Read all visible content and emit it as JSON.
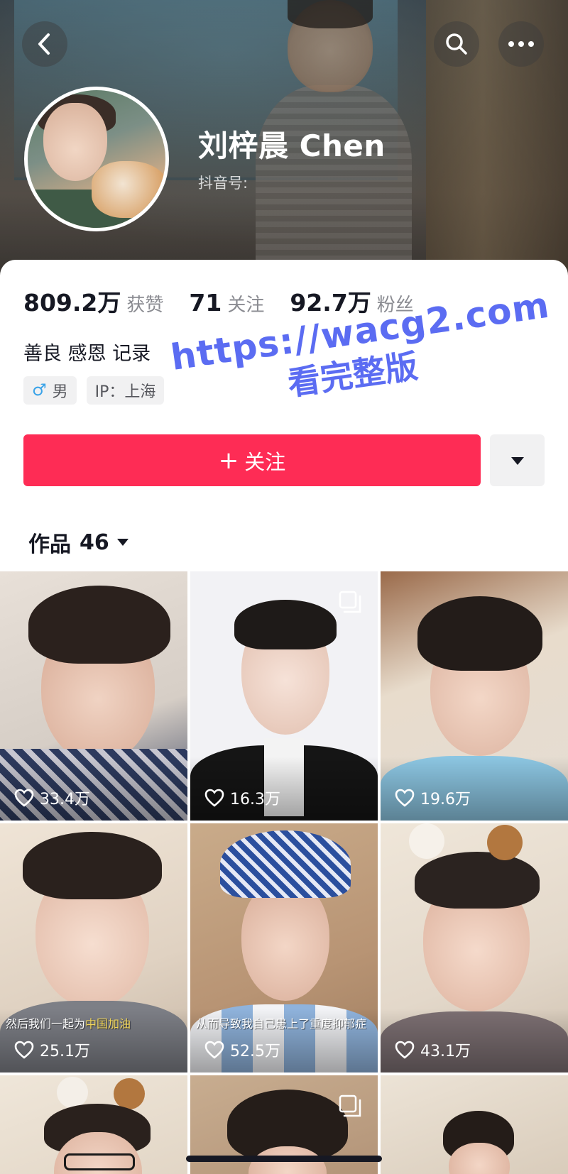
{
  "header": {
    "back_icon": "chevron-left-icon",
    "search_icon": "search-icon",
    "more_icon": "more-dots-icon"
  },
  "profile": {
    "name": "刘梓晨 Chen",
    "douyin_id_label": "抖音号:",
    "bio": "善良 感恩 记录",
    "gender_symbol": "♂",
    "gender": "男",
    "ip_label": "IP：上海"
  },
  "stats": [
    {
      "value": "809.2万",
      "label": "获赞"
    },
    {
      "value": "71",
      "label": "关注"
    },
    {
      "value": "92.7万",
      "label": "粉丝"
    }
  ],
  "watermark": {
    "url": "https://wacg2.com",
    "subtitle": "看完整版"
  },
  "actions": {
    "follow_label": "关注",
    "follow_plus": "+",
    "more_icon": "caret-down-icon"
  },
  "works": {
    "label": "作品",
    "count": "46"
  },
  "videos": [
    {
      "likes": "33.4万",
      "caption": ""
    },
    {
      "likes": "16.3万",
      "caption": "",
      "multi": true
    },
    {
      "likes": "19.6万",
      "caption": ""
    },
    {
      "likes": "25.1万",
      "caption_plain": "然后我们一起为",
      "caption_highlight": "中国加油"
    },
    {
      "likes": "52.5万",
      "caption_plain": "从而导致我自己患上了重度抑郁症",
      "caption_highlight": ""
    },
    {
      "likes": "43.1万",
      "caption": ""
    },
    {
      "likes": "",
      "caption": ""
    },
    {
      "likes": "",
      "caption": "",
      "multi": true
    },
    {
      "likes": "",
      "caption": ""
    }
  ],
  "colors": {
    "accent": "#fe2c55",
    "text": "#161823",
    "muted": "#8a8b91",
    "watermark": "#5b6cf2"
  }
}
